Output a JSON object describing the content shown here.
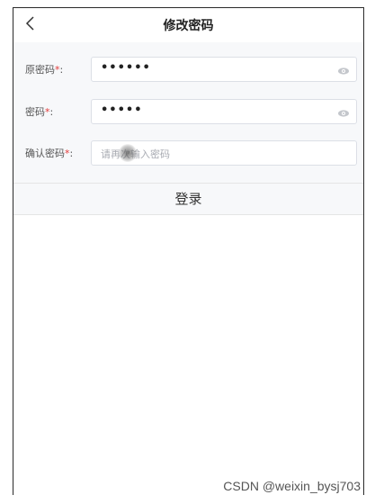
{
  "navbar": {
    "back_icon": "chevron-left-icon",
    "title": "修改密码"
  },
  "form": {
    "old_password": {
      "label": "原密码",
      "required_mark": "*",
      "colon": ":",
      "value": "••••••",
      "icon": "eye-icon"
    },
    "new_password": {
      "label": "密码",
      "required_mark": "*",
      "colon": ":",
      "value": "•••••",
      "icon": "eye-icon"
    },
    "confirm_password": {
      "label": "确认密码",
      "required_mark": "*",
      "colon": ":",
      "placeholder": "请再次输入密码"
    }
  },
  "submit": {
    "label": "登录"
  },
  "watermark": "CSDN @weixin_bysj703",
  "colors": {
    "required": "#e23a3a",
    "background": "#f7f8fa",
    "border": "#dcdfe6"
  }
}
